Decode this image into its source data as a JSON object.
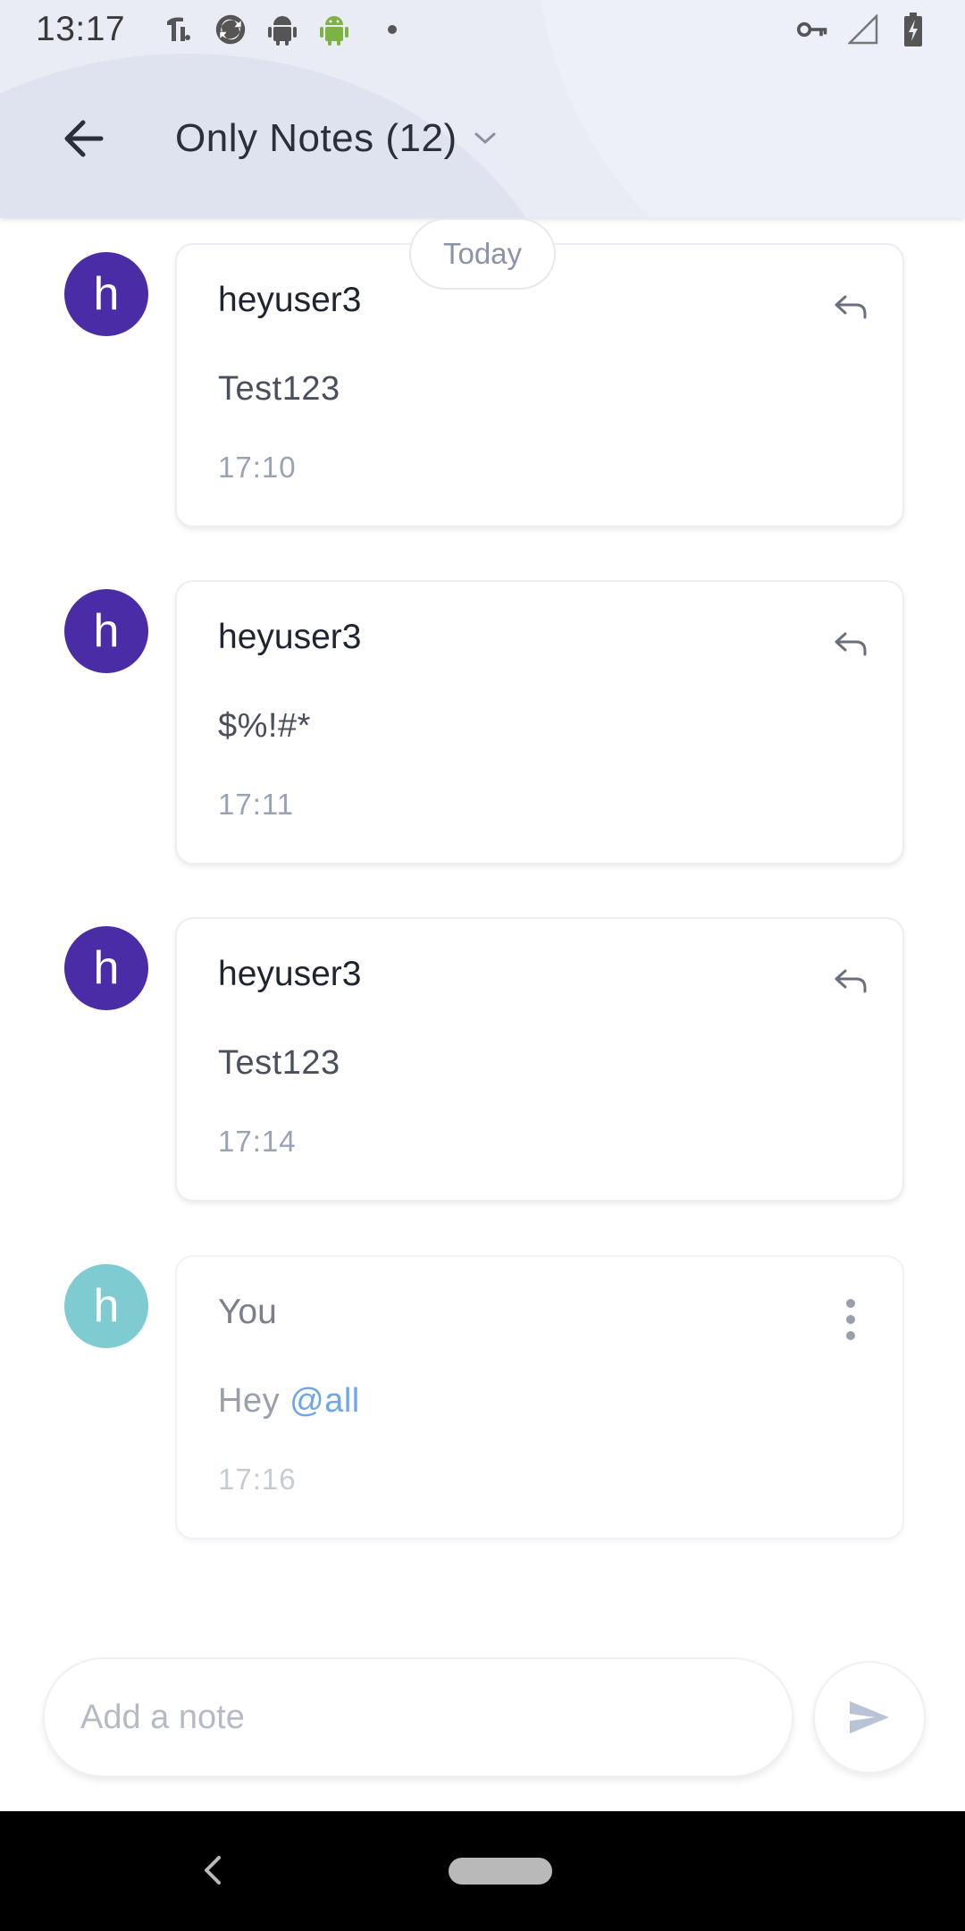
{
  "status_bar": {
    "time": "13:17",
    "left_icons": [
      "tools-icon",
      "sync-icon",
      "android-dark-icon",
      "android-green-icon"
    ],
    "right_icons": [
      "vpn-key-icon",
      "signal-icon",
      "battery-icon"
    ]
  },
  "header": {
    "title": "Only Notes (12)"
  },
  "chat": {
    "date_pill": "Today",
    "messages": [
      {
        "avatar_letter": "h",
        "author": "heyuser3",
        "body": "Test123",
        "time": "17:10"
      },
      {
        "avatar_letter": "h",
        "author": "heyuser3",
        "body": "$%!#*",
        "time": "17:11"
      },
      {
        "avatar_letter": "h",
        "author": "heyuser3",
        "body": "Test123",
        "time": "17:14"
      },
      {
        "avatar_letter": "h",
        "author": "You",
        "body_prefix": "Hey ",
        "body_mention": "@all",
        "time": "17:16"
      }
    ]
  },
  "composer": {
    "placeholder": "Add a note"
  },
  "colors": {
    "avatar_other": "#4a2ca6",
    "avatar_self": "#7ecbd2",
    "mention": "#6fa6e8",
    "header_bg": "#e9ecf5"
  }
}
